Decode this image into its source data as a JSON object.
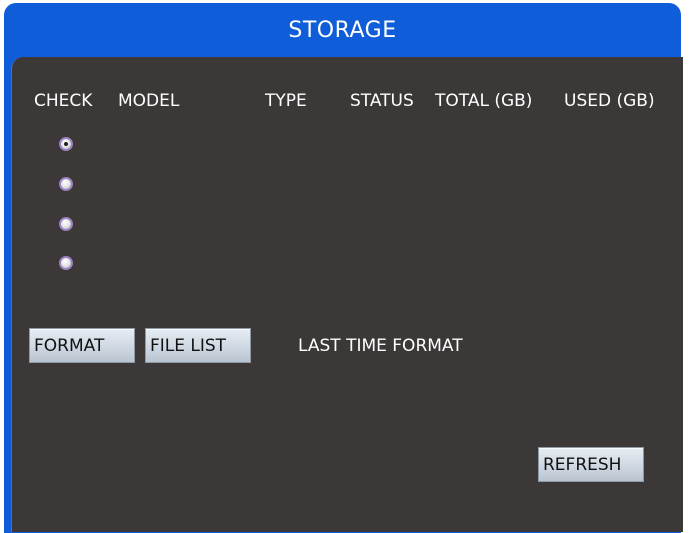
{
  "window": {
    "title": "STORAGE"
  },
  "table": {
    "columns": [
      "CHECK",
      "MODEL",
      "TYPE",
      "STATUS",
      "TOTAL (GB)",
      "USED (GB)"
    ],
    "rows": [
      {
        "checked": true
      },
      {
        "checked": false
      },
      {
        "checked": false
      },
      {
        "checked": false
      }
    ]
  },
  "actions": {
    "format_label": "FORMAT",
    "file_list_label": "FILE LIST",
    "last_time_format_label": "LAST TIME FORMAT",
    "refresh_label": "REFRESH"
  },
  "colors": {
    "title_bar": "#0f5dd8",
    "panel": "#3b3837",
    "text": "#ffffff",
    "button": "#cfd8e2"
  }
}
